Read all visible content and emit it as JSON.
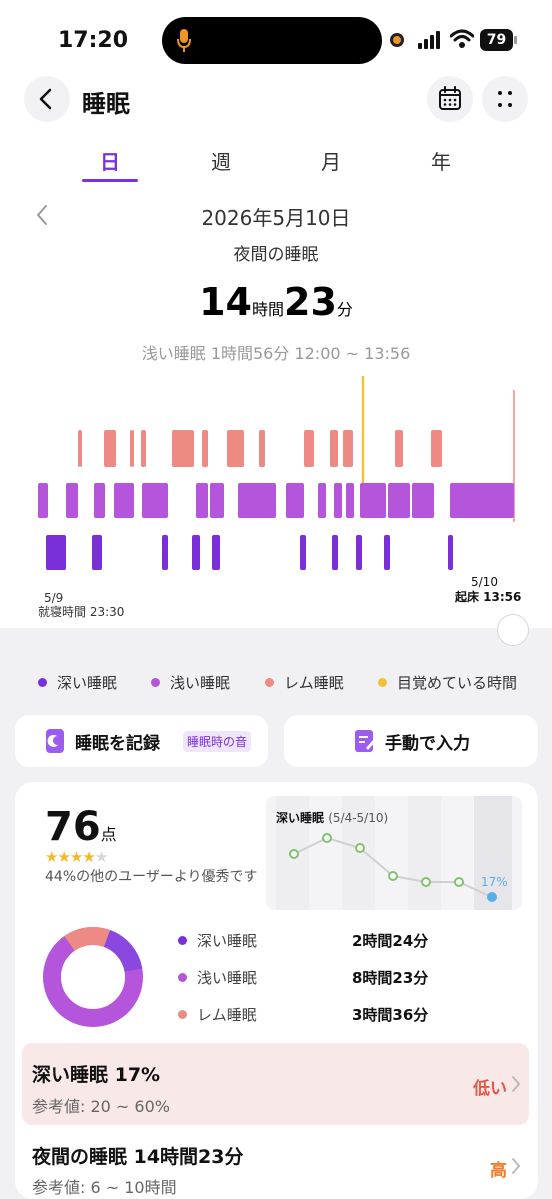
{
  "status_bar": {
    "time": "17:20",
    "battery": "79"
  },
  "nav": {
    "title": "睡眠"
  },
  "tabs": [
    "日",
    "週",
    "月",
    "年"
  ],
  "date": "2026年5月10日",
  "sub_title": "夜間の睡眠",
  "total": {
    "hours": "14",
    "hours_unit": "時間",
    "minutes": "23",
    "minutes_unit": "分"
  },
  "detail_line": "浅い睡眠 1時間56分 12:00 ~ 13:56",
  "timeline": {
    "start_date": "5/9",
    "start_label": "就寝時間 23:30",
    "end_date": "5/10",
    "end_label": "起床 13:56"
  },
  "colors": {
    "deep": "#7b2fd8",
    "light": "#b455dc",
    "rem": "#ee8a84",
    "awake": "#f2c236",
    "accent": "#7b32d6",
    "low_status": "#e05a45",
    "high_status": "#f07c28"
  },
  "legend": [
    {
      "label": "深い睡眠",
      "color": "#7b2fd8"
    },
    {
      "label": "浅い睡眠",
      "color": "#b455dc"
    },
    {
      "label": "レム睡眠",
      "color": "#ee8a84"
    },
    {
      "label": "目覚めている時間",
      "color": "#f2c236"
    }
  ],
  "actions": {
    "record_label": "睡眠を記録",
    "record_tag": "睡眠時の音",
    "manual_label": "手動で入力"
  },
  "score": {
    "value": "76",
    "unit": "点",
    "stars_filled": 4,
    "stars_total": 5,
    "beat_text": "44%の他のユーザーより優秀です"
  },
  "mini_chart": {
    "title": "深い睡眠",
    "range": "(5/4-5/10)",
    "last_value_label": "17%"
  },
  "stages": [
    {
      "name": "深い睡眠",
      "duration": "2時間24分",
      "color": "#7b2fd8"
    },
    {
      "name": "浅い睡眠",
      "duration": "8時間23分",
      "color": "#b455dc"
    },
    {
      "name": "レム睡眠",
      "duration": "3時間36分",
      "color": "#ee8a84"
    }
  ],
  "deep_row": {
    "title": "深い睡眠 17%",
    "ref": "参考値:  20 ~ 60%",
    "status": "低い"
  },
  "night_row": {
    "title": "夜間の睡眠 14時間23分",
    "ref": "参考値:  6 ~ 10時間",
    "status": "高"
  }
}
